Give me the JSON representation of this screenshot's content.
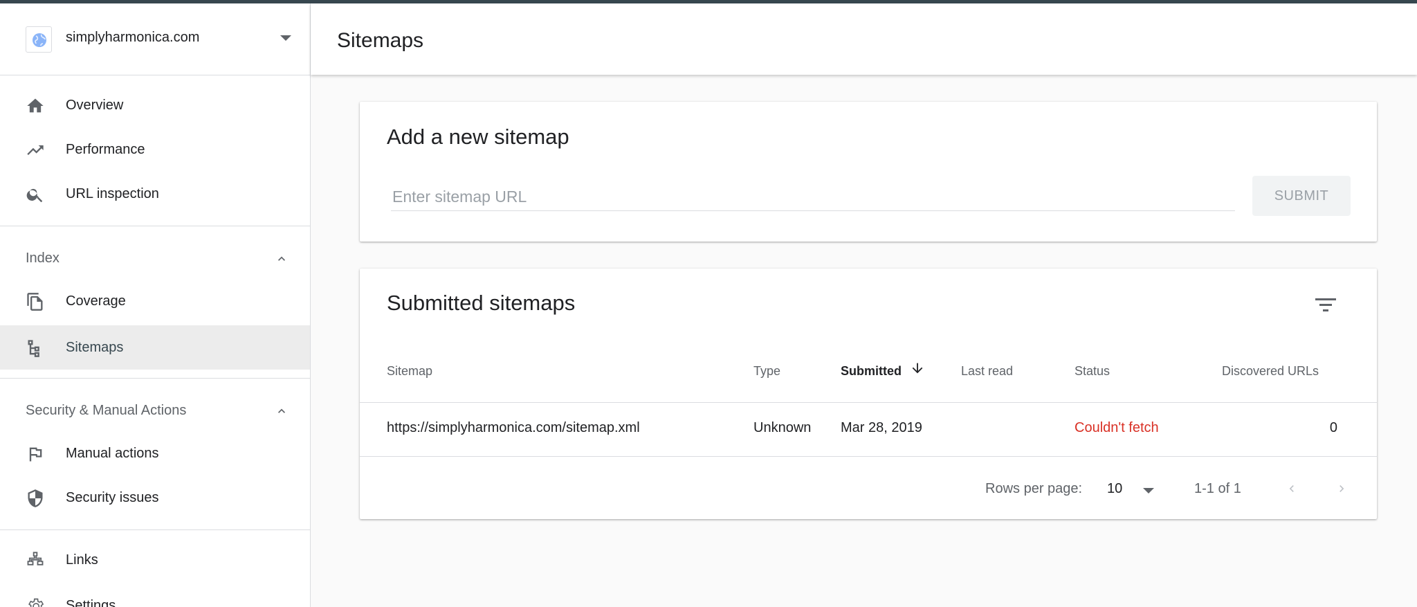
{
  "property": {
    "name": "simplyharmonica.com",
    "icon": "globe-icon"
  },
  "nav": {
    "overview": "Overview",
    "performance": "Performance",
    "url_inspection": "URL inspection",
    "index_section": "Index",
    "coverage": "Coverage",
    "sitemaps": "Sitemaps",
    "security_section": "Security & Manual Actions",
    "manual_actions": "Manual actions",
    "security_issues": "Security issues",
    "links": "Links",
    "settings": "Settings"
  },
  "header": {
    "title": "Sitemaps"
  },
  "add_card": {
    "title": "Add a new sitemap",
    "input_placeholder": "Enter sitemap URL",
    "input_value": "",
    "submit_label": "SUBMIT"
  },
  "list_card": {
    "title": "Submitted sitemaps",
    "columns": [
      "Sitemap",
      "Type",
      "Submitted",
      "Last read",
      "Status",
      "Discovered URLs"
    ],
    "sorted_column": "Submitted",
    "rows": [
      {
        "sitemap": "https://simplyharmonica.com/sitemap.xml",
        "type": "Unknown",
        "submitted": "Mar 28, 2019",
        "last_read": "",
        "status": "Couldn't fetch",
        "discovered_urls": "0"
      }
    ],
    "pagination": {
      "rows_per_page_label": "Rows per page:",
      "rows_per_page": "10",
      "range": "1-1 of 1"
    }
  },
  "colors": {
    "accent": "#37474f",
    "status_error": "#d93025",
    "active_bg": "#ececec"
  }
}
